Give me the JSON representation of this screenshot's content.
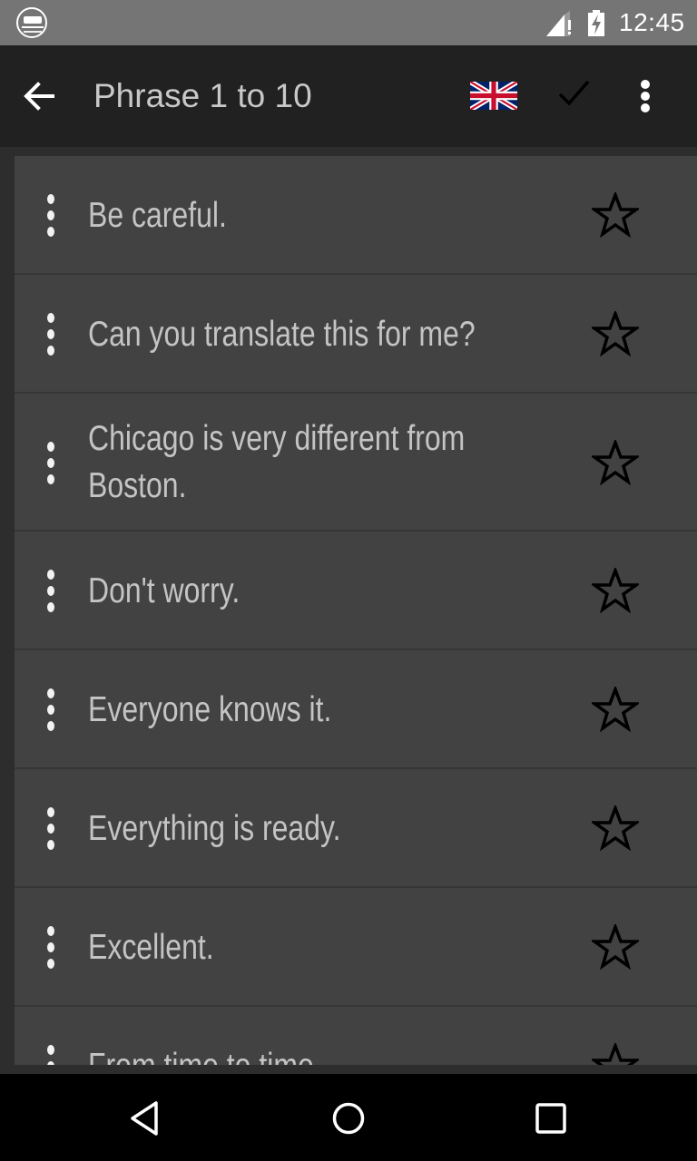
{
  "status_bar": {
    "time": "12:45",
    "icons": [
      "app-notification-icon",
      "signal-icon",
      "battery-charging-icon"
    ]
  },
  "app_bar": {
    "title": "Phrase 1 to 10",
    "back_icon": "arrow-back-icon",
    "language_flag": "uk-flag-icon",
    "check_icon": "check-icon",
    "overflow_icon": "more-vert-icon"
  },
  "phrases": [
    {
      "text": "Be careful.",
      "favorite": false
    },
    {
      "text": "Can you translate this for me?",
      "favorite": false
    },
    {
      "text": "Chicago is very different from Boston.",
      "favorite": false
    },
    {
      "text": "Don't worry.",
      "favorite": false
    },
    {
      "text": "Everyone knows it.",
      "favorite": false
    },
    {
      "text": "Everything is ready.",
      "favorite": false
    },
    {
      "text": "Excellent.",
      "favorite": false
    },
    {
      "text": "From time to time.",
      "favorite": false
    }
  ],
  "nav_bar": {
    "back": "nav-back-icon",
    "home": "nav-home-icon",
    "recents": "nav-recents-icon"
  },
  "colors": {
    "status_bar": "#757575",
    "app_bar": "#212121",
    "card": "#424242",
    "phrase_text": "#c4c4c4",
    "title_text": "#c8c8c8"
  }
}
